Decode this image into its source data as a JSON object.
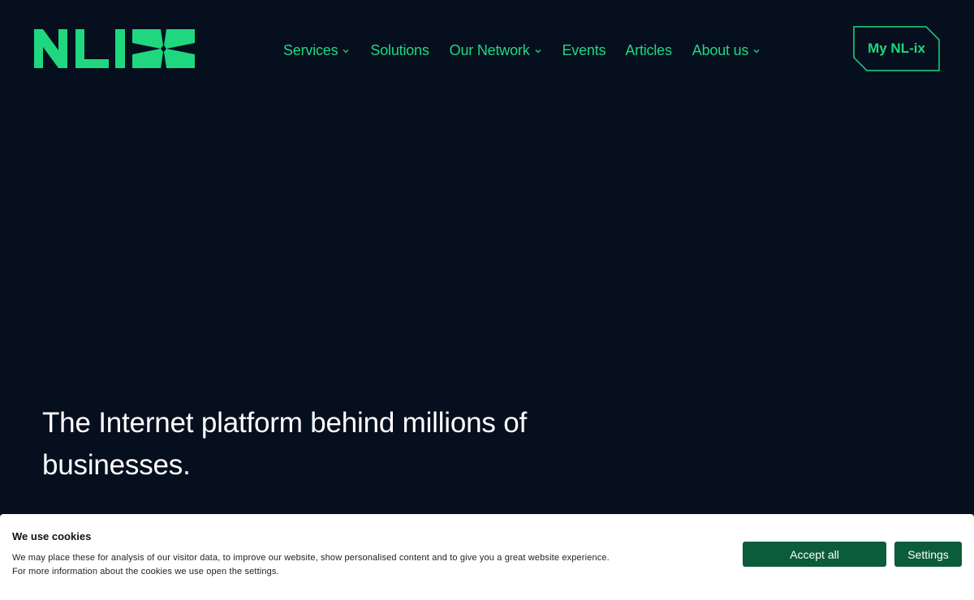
{
  "header": {
    "logo_text": "NLIX",
    "brand_color": "#1fd77f",
    "background_color": "#050f1e",
    "nav": [
      {
        "label": "Services",
        "has_dropdown": true
      },
      {
        "label": "Solutions",
        "has_dropdown": false
      },
      {
        "label": "Our Network",
        "has_dropdown": true
      },
      {
        "label": "Events",
        "has_dropdown": false
      },
      {
        "label": "Articles",
        "has_dropdown": false
      },
      {
        "label": "About us",
        "has_dropdown": true
      }
    ],
    "account_button_label": "My NL-ix"
  },
  "hero": {
    "title_line1": "The Internet platform behind millions of",
    "title_line2": "businesses."
  },
  "cookie_banner": {
    "title": "We use cookies",
    "text_line1": "We may place these for analysis of our visitor data, to improve our website, show personalised content and to give you a great website experience.",
    "text_line2": "For more information about the cookies we use open the settings.",
    "accept_label": "Accept all",
    "settings_label": "Settings",
    "button_color": "#0b5c3a"
  }
}
